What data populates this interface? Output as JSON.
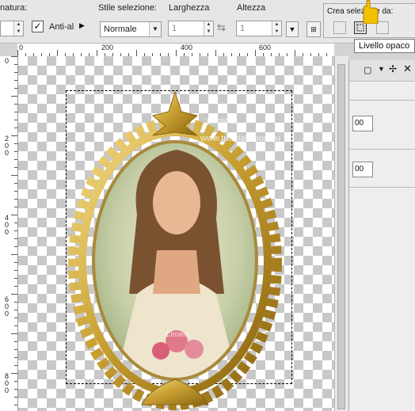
{
  "toolbar": {
    "feather_label": "natura:",
    "antialias_label": "Anti-al",
    "style_label": "Stile selezione:",
    "style_value": "Normale",
    "width_label": "Larghezza",
    "width_value": "1",
    "height_label": "Altezza",
    "height_value": "1",
    "crea_label": "Crea selezione da:"
  },
  "tooltip": "Livello opaco",
  "ruler": {
    "h": [
      "0",
      "200",
      "400",
      "600"
    ],
    "v": [
      "0",
      "2 0 0",
      "4 0 0",
      "6 0 0",
      "8 0 0"
    ]
  },
  "panel": {
    "value1": "00",
    "value2": "00"
  },
  "watermark": {
    "line1": "Cimieta",
    "line2": "www.tutorialcloud.eu",
    "line3": "Cimieta"
  },
  "colors": {
    "frame_gold": "#c9a032",
    "toolbar_bg": "#e6e6e6",
    "cursor_yellow": "#f2c200"
  }
}
